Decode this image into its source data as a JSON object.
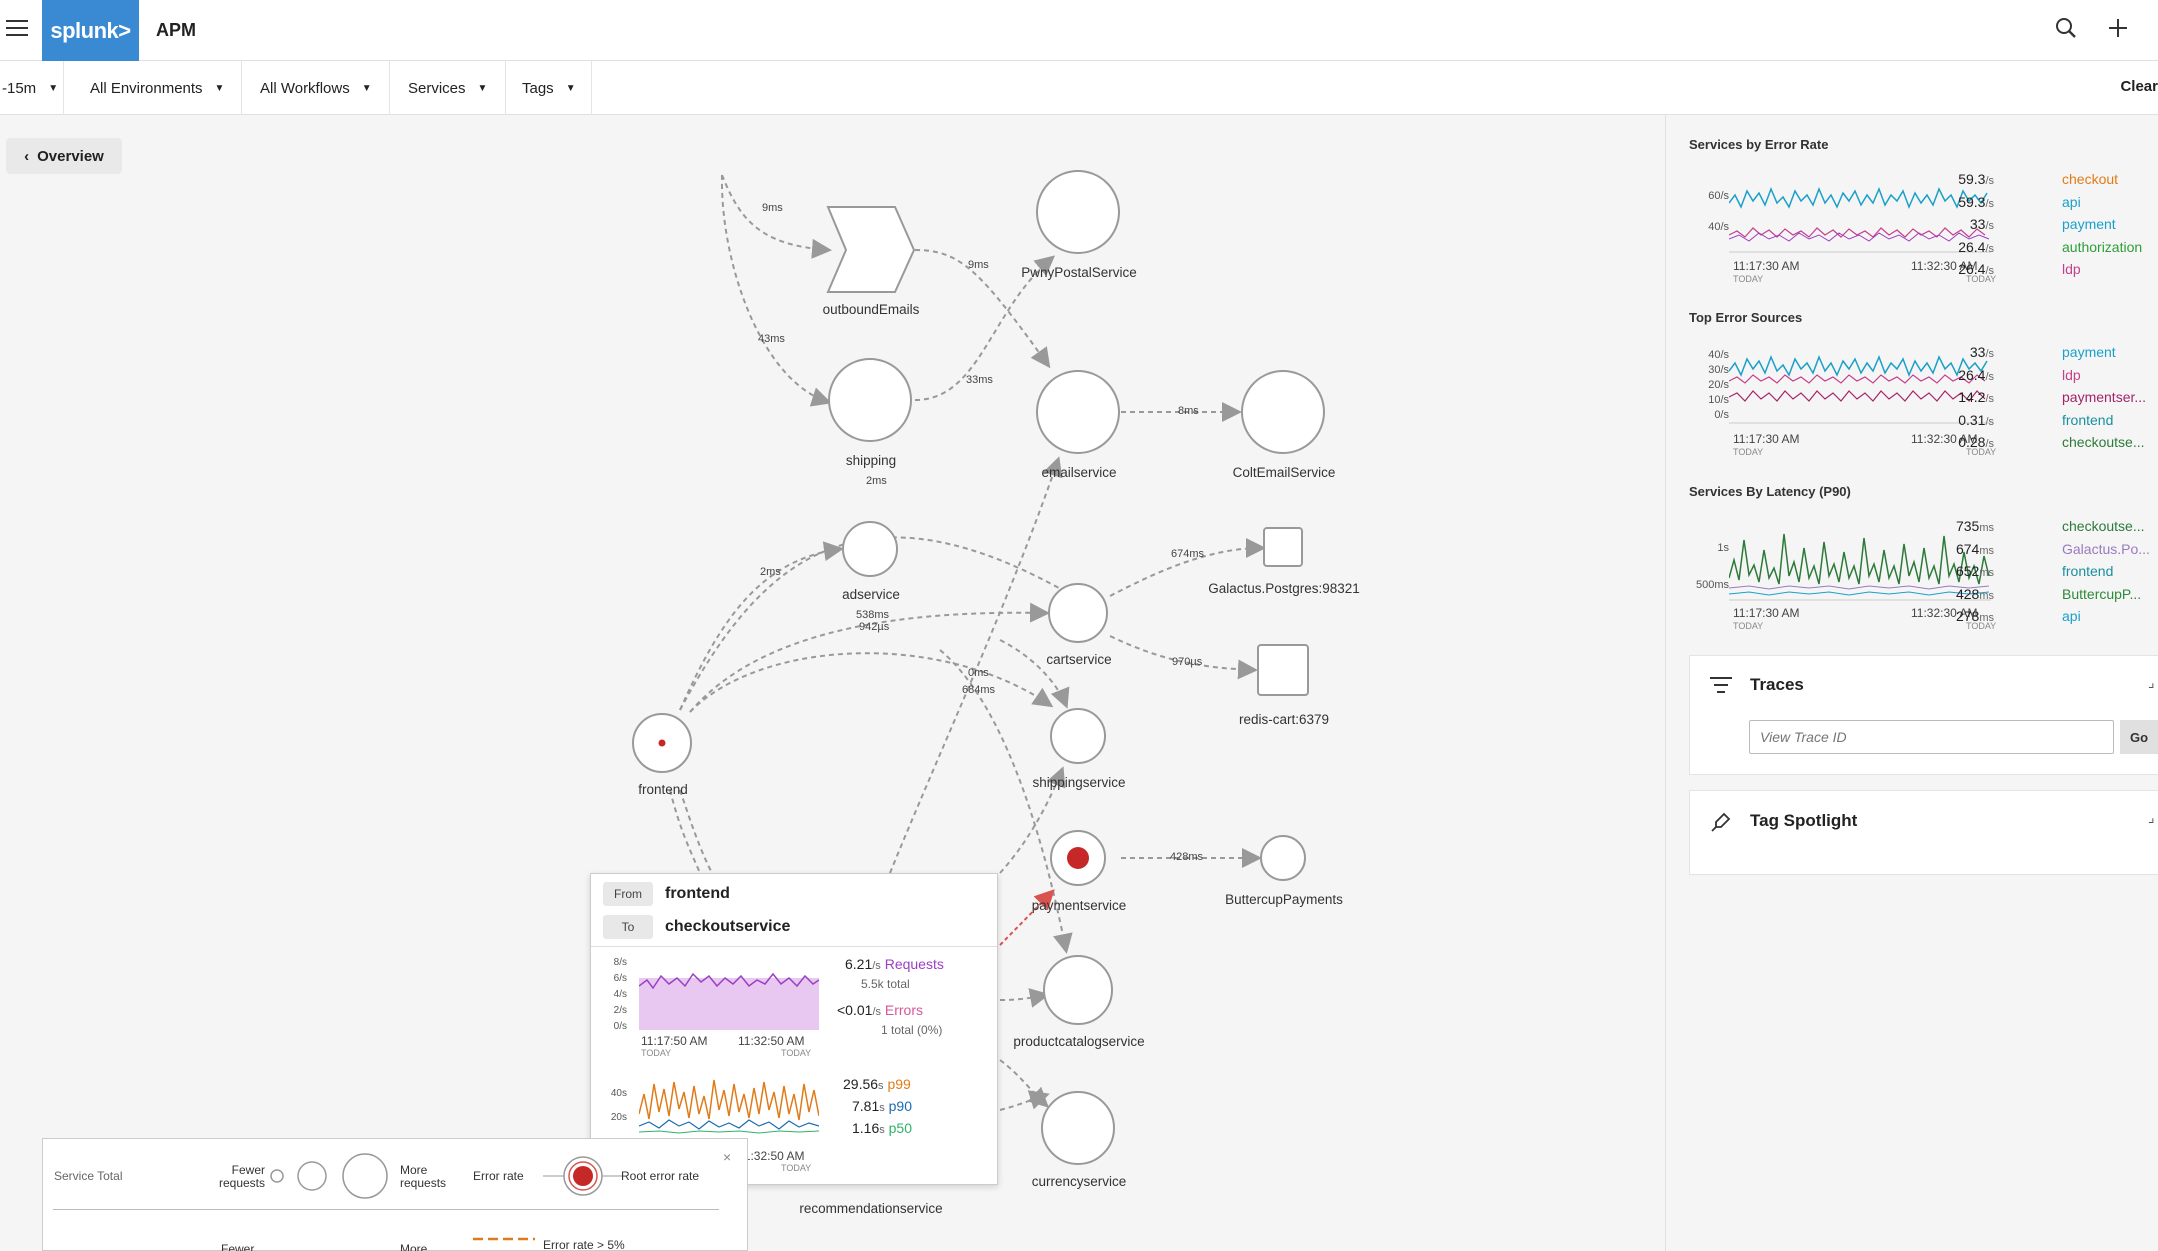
{
  "app": {
    "logo": "splunk>",
    "title": "APM"
  },
  "filters": {
    "time": "-15m",
    "environments": "All Environments",
    "workflows": "All Workflows",
    "services": "Services",
    "tags": "Tags",
    "clear": "Clear"
  },
  "overview_label": "Overview",
  "nodes": {
    "outboundEmails": "outboundEmails",
    "PwnyPostalService": "PwnyPostalService",
    "shipping": "shipping",
    "emailservice": "emailservice",
    "ColtEmailService": "ColtEmailService",
    "adservice": "adservice",
    "cartservice": "cartservice",
    "galactus": "Galactus.Postgres:98321",
    "redis": "redis-cart:6379",
    "frontend": "frontend",
    "shippingservice": "shippingservice",
    "paymentservice": "paymentservice",
    "ButtercupPayments": "ButtercupPayments",
    "productcatalogservice": "productcatalogservice",
    "currencyservice": "currencyservice",
    "recommendationservice": "recommendationservice"
  },
  "edges": {
    "e1": "9ms",
    "e2": "9ms",
    "e3": "43ms",
    "e4": "33ms",
    "e5": "8ms",
    "e6": "2ms",
    "e7": "2ms",
    "e8": "538ms",
    "e9": "942µs",
    "e10": "674ms",
    "e11": "970µs",
    "e12": "0ms",
    "e13": "684ms",
    "e14": "428ms"
  },
  "tooltip": {
    "from_tag": "From",
    "from": "frontend",
    "to_tag": "To",
    "to": "checkoutservice",
    "axis1": [
      "8/s",
      "6/s",
      "4/s",
      "2/s",
      "0/s"
    ],
    "axis2": [
      "40s",
      "20s"
    ],
    "time_start": "11:17:50 AM",
    "time_end": "11:32:50 AM",
    "today": "TODAY",
    "requests_value": "6.21",
    "requests_unit": "/s",
    "requests_label": "Requests",
    "requests_total": "5.5k total",
    "errors_value": "<0.01",
    "errors_unit": "/s",
    "errors_label": "Errors",
    "errors_total": "1 total (0%)",
    "p99_value": "29.56",
    "p99_unit": "s",
    "p99_label": "p99",
    "p90_value": "7.81",
    "p90_unit": "s",
    "p90_label": "p90",
    "p50_value": "1.16",
    "p50_unit": "s",
    "p50_label": "p50",
    "colors": {
      "requests": "#9b3fc5",
      "errors": "#d9559b",
      "p99": "#e07b1a",
      "p90": "#1a6bb0",
      "p50": "#2db36a"
    }
  },
  "legend": {
    "service_total": "Service Total",
    "fewer_requests": "Fewer requests",
    "more_requests": "More requests",
    "error_rate": "Error rate",
    "root_error_rate": "Root error rate",
    "fewer2": "Fewer",
    "more2": "More",
    "error_rate_gt": "Error rate > 5%"
  },
  "panel": {
    "error_rate": {
      "title": "Services by Error Rate",
      "axis": [
        "60/s",
        "40/s"
      ],
      "time_start": "11:17:30 AM",
      "time_end": "11:32:30 AM",
      "today": "TODAY",
      "rows": [
        {
          "value": "59.3",
          "unit": "/s",
          "name": "checkout",
          "color": "#e07b1a"
        },
        {
          "value": "59.3",
          "unit": "/s",
          "name": "api",
          "color": "#1aa0c9"
        },
        {
          "value": "33",
          "unit": "/s",
          "name": "payment",
          "color": "#1aa0c9"
        },
        {
          "value": "26.4",
          "unit": "/s",
          "name": "authorization",
          "color": "#2d9e3a"
        },
        {
          "value": "26.4",
          "unit": "/s",
          "name": "ldp",
          "color": "#c4408a"
        }
      ]
    },
    "error_sources": {
      "title": "Top Error Sources",
      "axis": [
        "40/s",
        "30/s",
        "20/s",
        "10/s",
        "0/s"
      ],
      "time_start": "11:17:30 AM",
      "time_end": "11:32:30 AM",
      "today": "TODAY",
      "rows": [
        {
          "value": "33",
          "unit": "/s",
          "name": "payment",
          "color": "#1aa0c9"
        },
        {
          "value": "26.4",
          "unit": "/s",
          "name": "ldp",
          "color": "#c4408a"
        },
        {
          "value": "14.2",
          "unit": "/s",
          "name": "paymentser...",
          "color": "#a3236b"
        },
        {
          "value": "0.31",
          "unit": "/s",
          "name": "frontend",
          "color": "#1a8fa0"
        },
        {
          "value": "0.28",
          "unit": "/s",
          "name": "checkoutse...",
          "color": "#2d7a3a"
        }
      ]
    },
    "latency": {
      "title": "Services By Latency (P90)",
      "axis": [
        "1s",
        "500ms"
      ],
      "time_start": "11:17:30 AM",
      "time_end": "11:32:30 AM",
      "today": "TODAY",
      "rows": [
        {
          "value": "735",
          "unit": "ms",
          "name": "checkoutse...",
          "color": "#2d7a3a"
        },
        {
          "value": "674",
          "unit": "ms",
          "name": "Galactus.Po...",
          "color": "#9a7abf"
        },
        {
          "value": "652",
          "unit": "ms",
          "name": "frontend",
          "color": "#1a8fa0"
        },
        {
          "value": "428",
          "unit": "ms",
          "name": "ButtercupP...",
          "color": "#2d8a3a"
        },
        {
          "value": "278",
          "unit": "ms",
          "name": "api",
          "color": "#1aa0c9"
        }
      ]
    },
    "traces": {
      "title": "Traces",
      "placeholder": "View Trace ID",
      "go": "Go"
    },
    "tag_spotlight": {
      "title": "Tag Spotlight"
    }
  }
}
